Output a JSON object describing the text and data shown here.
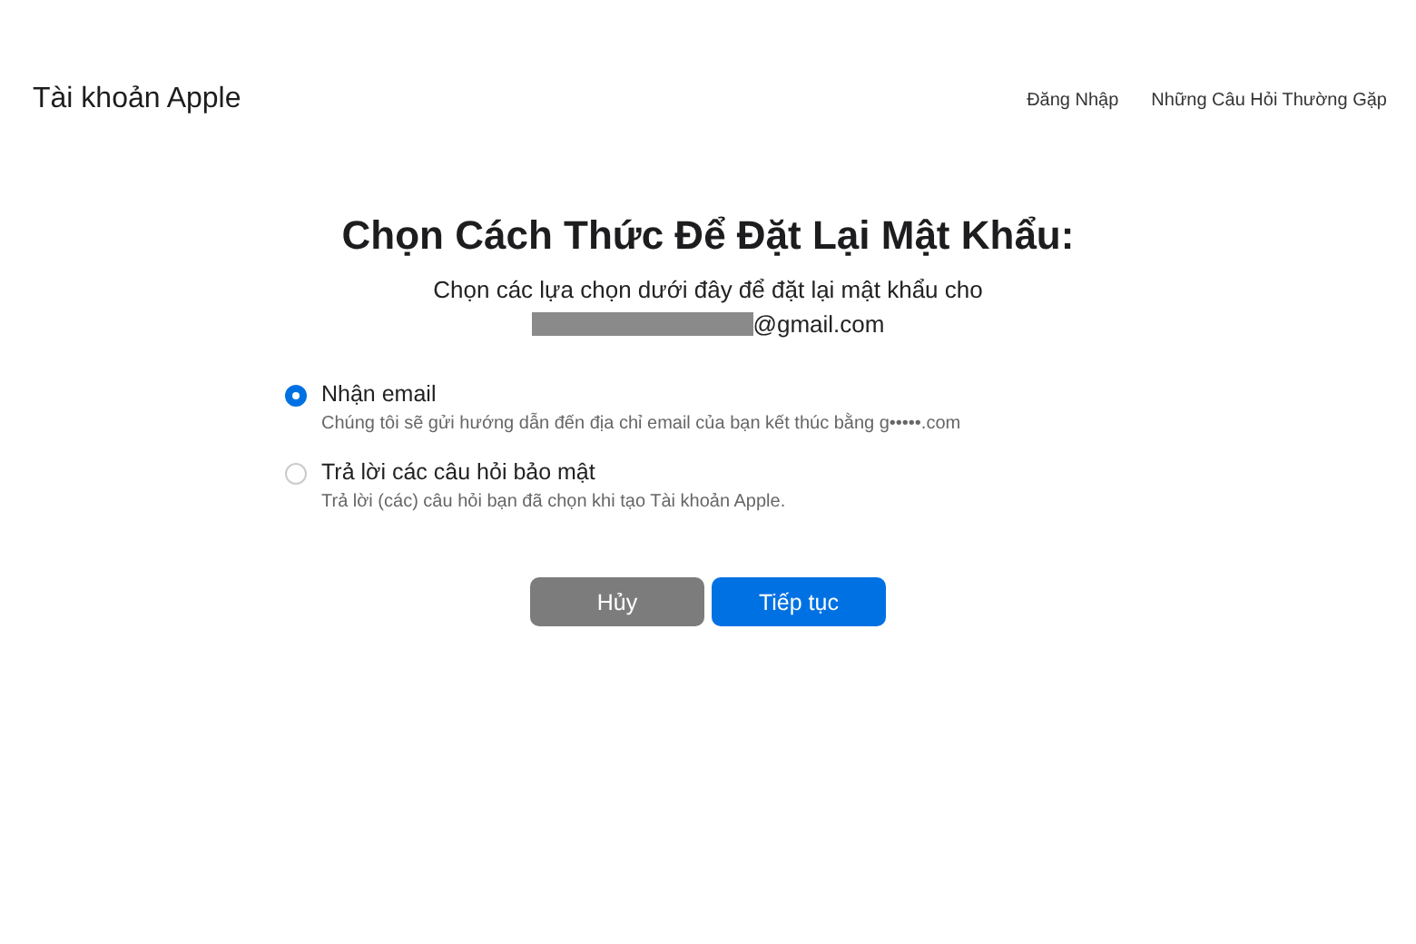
{
  "header": {
    "brand": "Tài khoản Apple",
    "links": [
      {
        "label": "Đăng Nhập"
      },
      {
        "label": "Những Câu Hỏi Thường Gặp"
      }
    ]
  },
  "heading": "Chọn Cách Thức Để Đặt Lại Mật Khẩu:",
  "subtitle": "Chọn các lựa chọn dưới đây để đặt lại mật khẩu cho",
  "email": "@gmail.com",
  "options": [
    {
      "label": "Nhận email",
      "description": "Chúng tôi sẽ gửi hướng dẫn đến địa chỉ email của bạn kết thúc bằng g•••••.com",
      "selected": true
    },
    {
      "label": "Trả lời các câu hỏi bảo mật",
      "description": "Trả lời (các) câu hỏi bạn đã chọn khi tạo Tài khoản Apple.",
      "selected": false
    }
  ],
  "buttons": [
    {
      "label": "Hủy",
      "kind": "secondary"
    },
    {
      "label": "Tiếp tục",
      "kind": "primary"
    }
  ]
}
